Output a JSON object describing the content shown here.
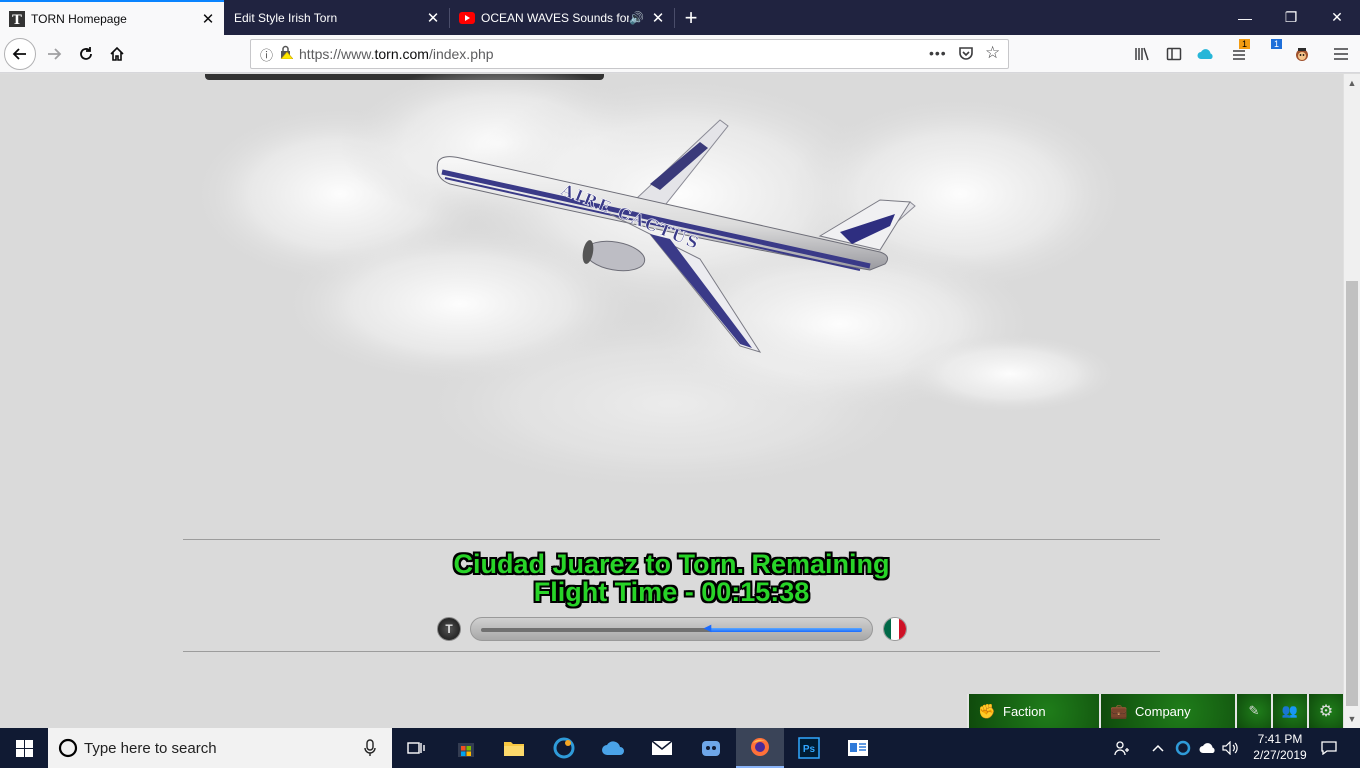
{
  "browser": {
    "tabs": [
      {
        "title": "TORN Homepage",
        "active": true,
        "icon": "torn-icon"
      },
      {
        "title": "Edit Style Irish Torn",
        "active": false,
        "icon": ""
      },
      {
        "title": "OCEAN WAVES Sounds for S",
        "active": false,
        "icon": "youtube-icon",
        "audio": true
      }
    ],
    "url_prefix": "https://www.",
    "url_domain": "torn.com",
    "url_path": "/index.php",
    "badges": {
      "notification_1": "1",
      "notification_2": "1"
    }
  },
  "page": {
    "airline_name": "AIRE CACTUS",
    "travel_line1": "Ciudad Juarez to Torn. Remaining",
    "travel_line2": "Flight Time - 00:15:38",
    "origin_label": "T",
    "progress": 0.4,
    "bottom_buttons": [
      {
        "label": "Faction",
        "icon": "fist-icon"
      },
      {
        "label": "Company",
        "icon": "briefcase-icon"
      }
    ],
    "colors": {
      "travel_text": "#28d428",
      "progress_fill": "#1a6bff",
      "button_green": "#1f7d1a"
    }
  },
  "taskbar": {
    "search_placeholder": "Type here to search",
    "time": "7:41 PM",
    "date": "2/27/2019"
  }
}
